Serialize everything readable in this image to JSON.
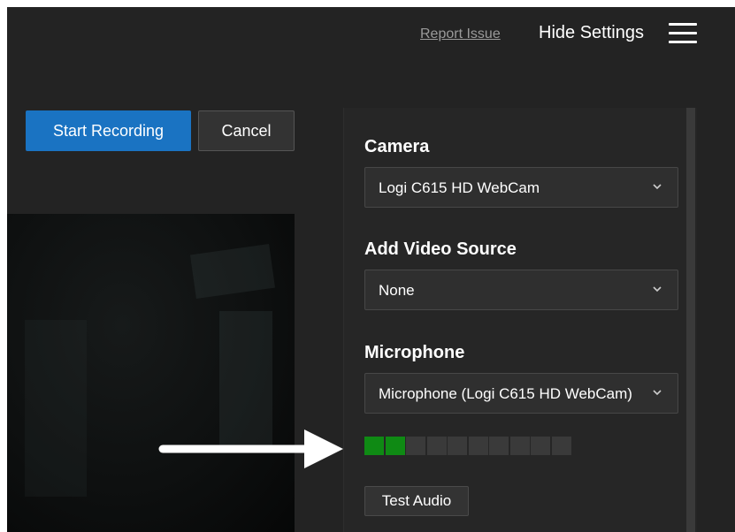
{
  "topbar": {
    "report_issue": "Report Issue",
    "hide_settings": "Hide Settings"
  },
  "actions": {
    "start_recording": "Start Recording",
    "cancel": "Cancel"
  },
  "settings": {
    "camera": {
      "label": "Camera",
      "value": "Logi C615 HD WebCam"
    },
    "video_source": {
      "label": "Add Video Source",
      "value": "None"
    },
    "microphone": {
      "label": "Microphone",
      "value": "Microphone (Logi C615 HD WebCam)"
    },
    "audio_level": {
      "active_segments": 2,
      "total_segments": 10,
      "active_color": "#0f8a14"
    },
    "test_audio": "Test Audio"
  },
  "colors": {
    "primary": "#1a73c2",
    "background": "#232323"
  },
  "icons": {
    "menu": "hamburger-menu-icon",
    "dropdown": "chevron-down-icon",
    "annotation": "arrow-right-icon"
  }
}
